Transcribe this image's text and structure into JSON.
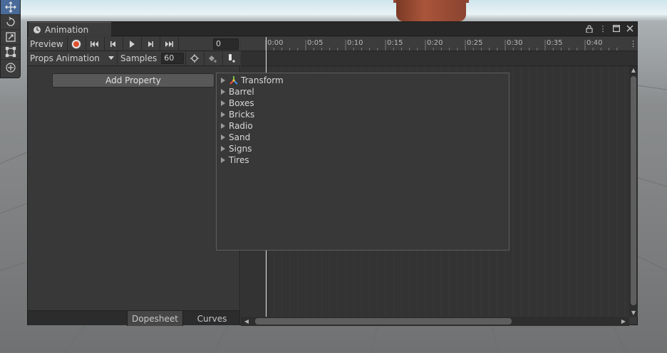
{
  "window": {
    "tab_label": "Animation",
    "controls": [
      "lock-icon",
      "kebab-menu-icon",
      "maximize-icon",
      "close-icon"
    ]
  },
  "toolbar": {
    "preview_label": "Preview",
    "record_color": "#e0502e",
    "frame_value": "0",
    "clip_name": "Props Animation",
    "samples_label": "Samples",
    "samples_value": "60"
  },
  "left_panel": {
    "add_property_label": "Add Property"
  },
  "bottom_tabs": {
    "dopesheet": "Dopesheet",
    "curves": "Curves"
  },
  "ruler": {
    "ticks": [
      "0:00",
      "0:05",
      "0:10",
      "0:15",
      "0:20",
      "0:25",
      "0:30",
      "0:35",
      "0:40"
    ]
  },
  "popup": {
    "items": [
      {
        "label": "Transform",
        "icon": "transform-icon"
      },
      {
        "label": "Barrel",
        "icon": ""
      },
      {
        "label": "Boxes",
        "icon": ""
      },
      {
        "label": "Bricks",
        "icon": ""
      },
      {
        "label": "Radio",
        "icon": ""
      },
      {
        "label": "Sand",
        "icon": ""
      },
      {
        "label": "Signs",
        "icon": ""
      },
      {
        "label": "Tires",
        "icon": ""
      }
    ]
  },
  "scene_tools": [
    "move-tool-icon",
    "rotate-tool-icon",
    "scale-tool-icon",
    "rect-tool-icon",
    "transform-tool-icon"
  ]
}
